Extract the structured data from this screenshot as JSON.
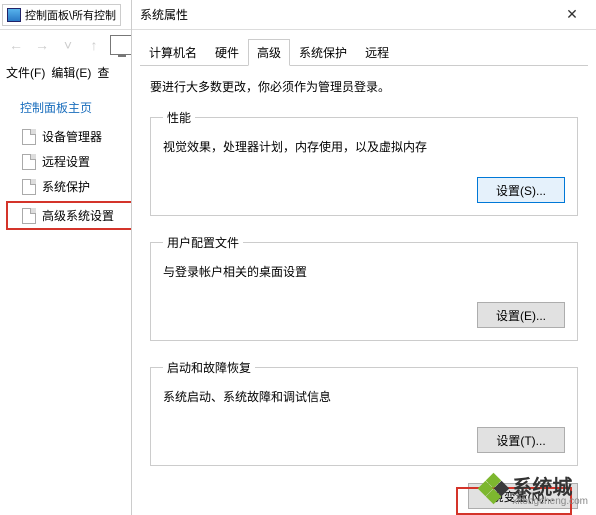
{
  "explorer": {
    "breadcrumb": "控制面板\\所有控制",
    "menu": {
      "file": "文件(F)",
      "edit": "编辑(E)",
      "view": "查"
    }
  },
  "sidebar": {
    "title": "控制面板主页",
    "items": [
      {
        "label": "设备管理器"
      },
      {
        "label": "远程设置"
      },
      {
        "label": "系统保护"
      },
      {
        "label": "高级系统设置"
      }
    ]
  },
  "dialog": {
    "title": "系统属性",
    "close": "✕",
    "tabs": [
      "计算机名",
      "硬件",
      "高级",
      "系统保护",
      "远程"
    ],
    "activeTab": 2,
    "note": "要进行大多数更改，你必须作为管理员登录。",
    "sections": {
      "perf": {
        "legend": "性能",
        "desc": "视觉效果，处理器计划，内存使用，以及虚拟内存",
        "btn": "设置(S)..."
      },
      "profile": {
        "legend": "用户配置文件",
        "desc": "与登录帐户相关的桌面设置",
        "btn": "设置(E)..."
      },
      "startup": {
        "legend": "启动和故障恢复",
        "desc": "系统启动、系统故障和调试信息",
        "btn": "设置(T)..."
      }
    },
    "envbtn": "境变量(N)..."
  },
  "watermark": {
    "text": "系统城",
    "url": "xitongcheng.com"
  }
}
